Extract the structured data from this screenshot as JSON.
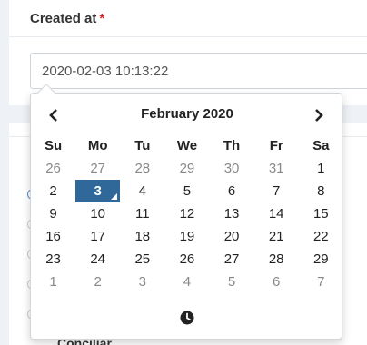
{
  "field": {
    "label": "Created at",
    "required_mark": "*",
    "value": "2020-02-03 10:13:22"
  },
  "background": {
    "partial_option_text": "Conciliar"
  },
  "datepicker": {
    "month_title": "February 2020",
    "prev_icon": "chevron-left-icon",
    "next_icon": "chevron-right-icon",
    "time_icon": "clock-icon",
    "weekdays": [
      "Su",
      "Mo",
      "Tu",
      "We",
      "Th",
      "Fr",
      "Sa"
    ],
    "weeks": [
      [
        "26",
        "27",
        "28",
        "29",
        "30",
        "31",
        "1"
      ],
      [
        "2",
        "3",
        "4",
        "5",
        "6",
        "7",
        "8"
      ],
      [
        "9",
        "10",
        "11",
        "12",
        "13",
        "14",
        "15"
      ],
      [
        "16",
        "17",
        "18",
        "19",
        "20",
        "21",
        "22"
      ],
      [
        "23",
        "24",
        "25",
        "26",
        "27",
        "28",
        "29"
      ],
      [
        "1",
        "2",
        "3",
        "4",
        "5",
        "6",
        "7"
      ]
    ],
    "selected_day": "3",
    "colors": {
      "selected_bg": "#2f6899",
      "other_month_text": "#888888",
      "required": "#e02424"
    }
  }
}
